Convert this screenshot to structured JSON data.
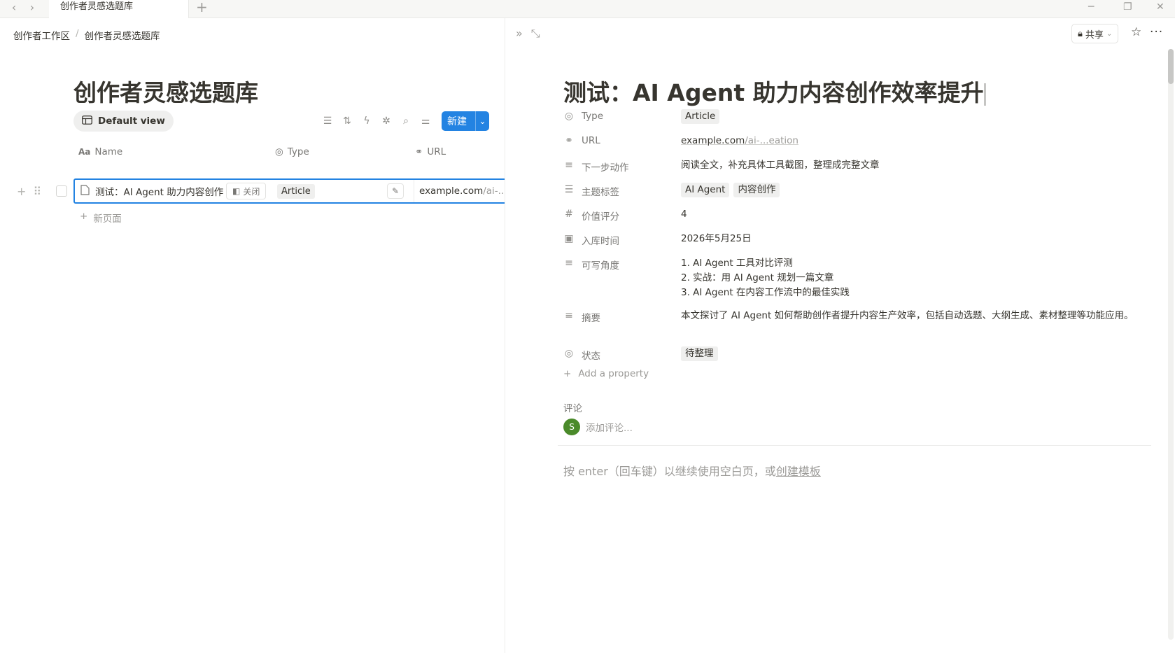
{
  "titlebar": {
    "tab_title": "创作者灵感选题库",
    "back_icon": "chevron-left",
    "forward_icon": "chevron-right",
    "new_tab_icon": "plus",
    "minimize_icon": "minimize",
    "maximize_icon": "restore",
    "close_icon": "close"
  },
  "breadcrumb": {
    "items": [
      "创作者工作区",
      "创作者灵感选题库"
    ],
    "separator": "/"
  },
  "database": {
    "title": "创作者灵感选题库",
    "view_label": "Default view",
    "new_button": "新建",
    "columns": {
      "name": "Name",
      "type": "Type",
      "url": "URL"
    },
    "rows": [
      {
        "name": "测试：AI Agent 助力内容创作",
        "open_label": "关闭",
        "type": "Article",
        "url_main": "example.com",
        "url_dim": "/ai-...ea"
      }
    ],
    "new_page_label": "新页面"
  },
  "peek": {
    "share_label": "共享",
    "title": "测试：AI Agent 助力内容创作效率提升",
    "properties": {
      "type": {
        "key": "Type",
        "value": "Article"
      },
      "url": {
        "key": "URL",
        "value_main": "example.com",
        "value_dim": "/ai-...eation"
      },
      "next_action": {
        "key": "下一步动作",
        "value": "阅读全文，补充具体工具截图，整理成完整文章"
      },
      "tags": {
        "key": "主题标签",
        "values": [
          "AI Agent",
          "内容创作"
        ]
      },
      "score": {
        "key": "价值评分",
        "value": "4"
      },
      "date": {
        "key": "入库时间",
        "value": "2026年5月25日"
      },
      "angles": {
        "key": "可写角度",
        "lines": [
          "1. AI Agent 工具对比评测",
          "2. 实战：用 AI Agent 规划一篇文章",
          "3. AI Agent 在内容工作流中的最佳实践"
        ]
      },
      "summary": {
        "key": "摘要",
        "value": "本文探讨了 AI Agent 如何帮助创作者提升内容生产效率，包括自动选题、大纲生成、素材整理等功能应用。"
      },
      "status": {
        "key": "状态",
        "value": "待整理"
      }
    },
    "add_property": "Add a property",
    "comments_label": "评论",
    "avatar_letter": "S",
    "comment_placeholder": "添加评论...",
    "hint_prefix": "按 enter（回车键）以继续使用空白页，或",
    "hint_link": "创建模板"
  },
  "colors": {
    "accent": "#2383e2",
    "avatar": "#4a8a2a",
    "chip_bg": "#efefee"
  }
}
